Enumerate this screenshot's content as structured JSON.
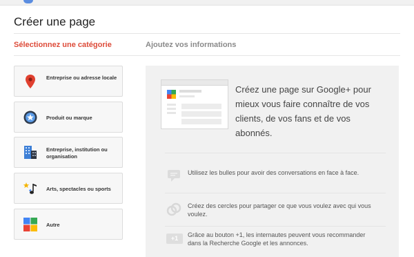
{
  "page": {
    "title": "Créer une page"
  },
  "steps": {
    "current": "Sélectionnez une catégorie",
    "next": "Ajoutez vos informations"
  },
  "categories": [
    {
      "label": "Entreprise ou adresse locale",
      "icon": "map-pin-icon"
    },
    {
      "label": "Produit ou marque",
      "icon": "product-tag-icon"
    },
    {
      "label": "Entreprise, institution ou organisation",
      "icon": "building-icon"
    },
    {
      "label": "Arts, spectacles ou sports",
      "icon": "music-star-icon"
    },
    {
      "label": "Autre",
      "icon": "four-squares-icon"
    }
  ],
  "promo": {
    "headline": "Créez une page sur Google+ pour mieux vous faire connaître de vos clients, de vos fans et de vos abonnés.",
    "features": [
      {
        "icon": "chat-bubble-icon",
        "text": "Utilisez les bulles pour avoir des conversations en face à face."
      },
      {
        "icon": "circles-icon",
        "text": "Créez des cercles pour partager ce que vous voulez avec qui vous voulez."
      },
      {
        "icon": "plus-one-icon",
        "badge": "+1",
        "text": "Grâce au bouton +1, les internautes peuvent vous recommander dans la Recherche Google et les annonces."
      }
    ]
  },
  "colors": {
    "accent": "#dd4b39",
    "muted": "#8a8a8a",
    "panel": "#f1f1f1"
  }
}
